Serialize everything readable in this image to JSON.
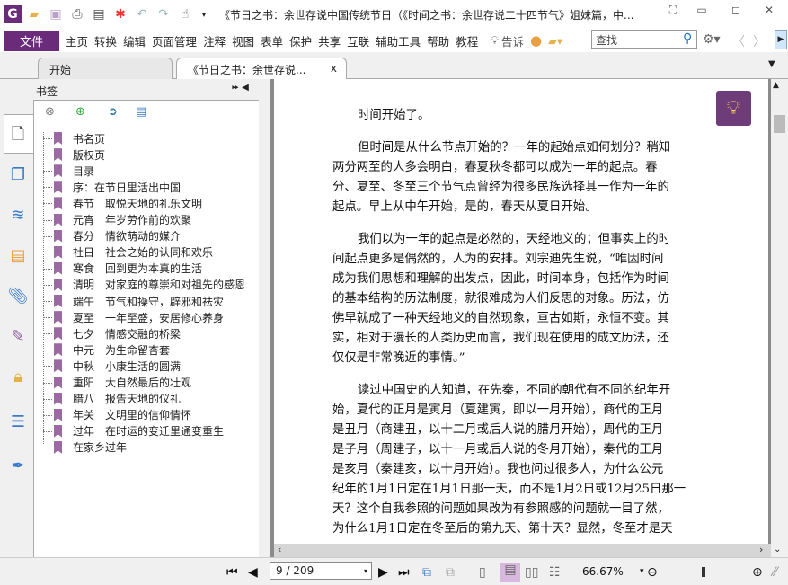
{
  "window": {
    "title": "《节日之书：余世存说中国传统节日（《时间之书：余世存说二十四节气》姐妹篇，中..."
  },
  "menubar": {
    "file": "文件",
    "items": [
      "主页",
      "转换",
      "编辑",
      "页面管理",
      "注释",
      "视图",
      "表单",
      "保护",
      "共享",
      "互联",
      "辅助工具",
      "帮助",
      "教程"
    ],
    "tell": "告诉",
    "search_placeholder": "查找"
  },
  "tabs": [
    {
      "label": "开始"
    },
    {
      "label": "《节日之书：余世存说...",
      "close": "x"
    }
  ],
  "bookmarks": {
    "title": "书签",
    "items": [
      "书名页",
      "版权页",
      "目录",
      "序：在节日里活出中国",
      "春节　取悦天地的礼乐文明",
      "元宵　年岁劳作前的欢聚",
      "春分　情欲萌动的媒介",
      "社日　社会之始的认同和欢乐",
      "寒食　回到更为本真的生活",
      "清明　对家庭的尊崇和对祖先的感恩",
      "端午　节气和操守，辟邪和祛灾",
      "夏至　一年至盛，安居修心养身",
      "七夕　情感交融的桥梁",
      "中元　为生命留杏套",
      "中秋　小康生活的圆满",
      "重阳　大自然最后的壮观",
      "腊八　报告天地的仪礼",
      "年关　文明里的信仰情怀",
      "过年　在时运的变迁里通变重生",
      "在家乡过年"
    ]
  },
  "document": {
    "paragraphs": [
      [
        "时间开始了。"
      ],
      [
        "但时间是从什么节点开始的？一年的起始点如何划分？稍知",
        "两分两至的人多会明白，春夏秋冬都可以成为一年的起点。春",
        "分、夏至、冬至三个节气点曾经为很多民族选择其一作为一年的",
        "起点。早上从中午开始，是的，春天从夏日开始。"
      ],
      [
        "我们以为一年的起点是必然的，天经地义的；但事实上的时",
        "间起点更多是偶然的，人为的安排。刘宗迪先生说，“唯因时间",
        "成为我们思想和理解的出发点，因此，时间本身，包括作为时间",
        "的基本结构的历法制度，就很难成为人们反思的对象。历法，仿",
        "佛早就成了一种天经地义的自然现象，亘古如斯，永恒不变。其",
        "实，相对于漫长的人类历史而言，我们现在使用的成文历法，还",
        "仅仅是非常晚近的事情。”"
      ],
      [
        "读过中国史的人知道，在先秦，不同的朝代有不同的纪年开",
        "始，夏代的正月是寅月（夏建寅，即以一月开始），商代的正月",
        "是丑月（商建丑，以十二月或后人说的腊月开始），周代的正月",
        "是子月（周建子，以十一月或后人说的冬月开始），秦代的正月",
        "是亥月（秦建亥，以十月开始）。我也问过很多人，为什么公元",
        "纪年的1月1日定在1月1日那一天，而不是1月2日或12月25日那一",
        "天？这个自我参照的问题如果改为有参照感的问题就一目了然，",
        "为什么1月1日定在冬至后的第九天、第十天？显然，冬至才是天"
      ]
    ]
  },
  "statusbar": {
    "page": "9 / 209",
    "zoom": "66.67%",
    "zoom_slider": 0.45
  },
  "colors": {
    "accent": "#6a2c7a",
    "bookmark": "#9b6aa3"
  }
}
